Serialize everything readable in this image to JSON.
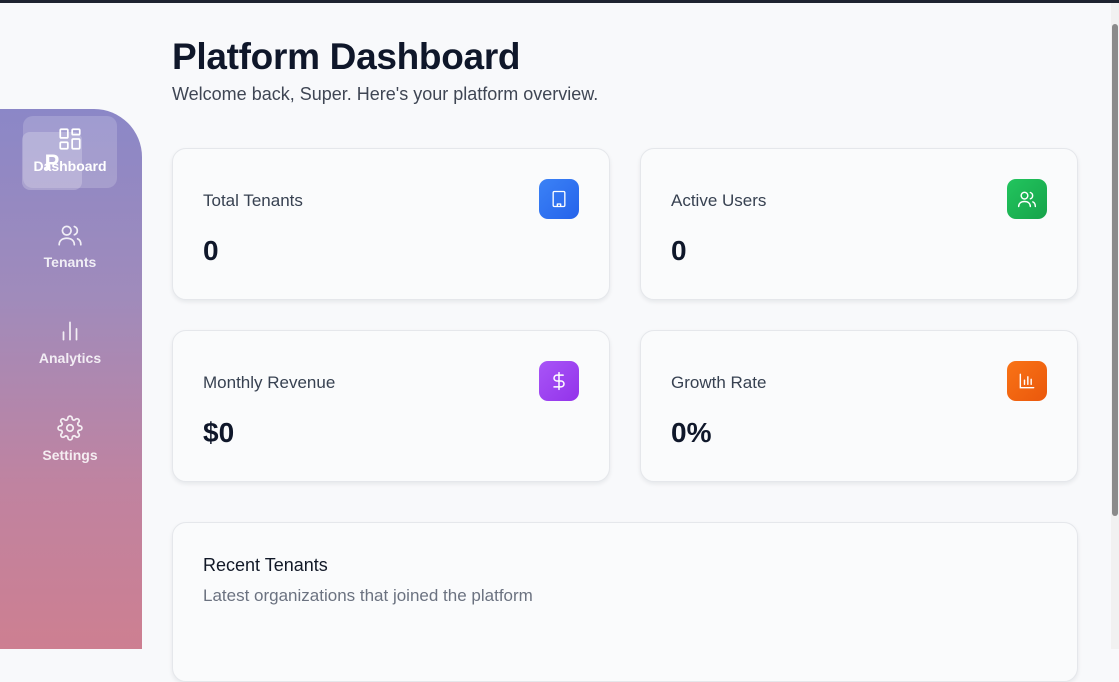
{
  "sidebar": {
    "logo_letter": "P",
    "items": [
      {
        "label": "Dashboard",
        "icon": "dashboard-grid-icon",
        "active": true
      },
      {
        "label": "Tenants",
        "icon": "users-icon",
        "active": false
      },
      {
        "label": "Analytics",
        "icon": "bar-chart-icon",
        "active": false
      },
      {
        "label": "Settings",
        "icon": "gear-icon",
        "active": false
      }
    ]
  },
  "header": {
    "title": "Platform Dashboard",
    "subtitle": "Welcome back, Super. Here's your platform overview."
  },
  "stats": [
    {
      "label": "Total Tenants",
      "value": "0",
      "icon": "building-icon",
      "color": "#2f6fe0"
    },
    {
      "label": "Active Users",
      "value": "0",
      "icon": "users-icon",
      "color": "#18a84a"
    },
    {
      "label": "Monthly Revenue",
      "value": "$0",
      "icon": "dollar-icon",
      "color": "#9333ea"
    },
    {
      "label": "Growth Rate",
      "value": "0%",
      "icon": "bar-chart-icon",
      "color": "#ee6a16"
    }
  ],
  "recent": {
    "title": "Recent Tenants",
    "subtitle": "Latest organizations that joined the platform"
  }
}
